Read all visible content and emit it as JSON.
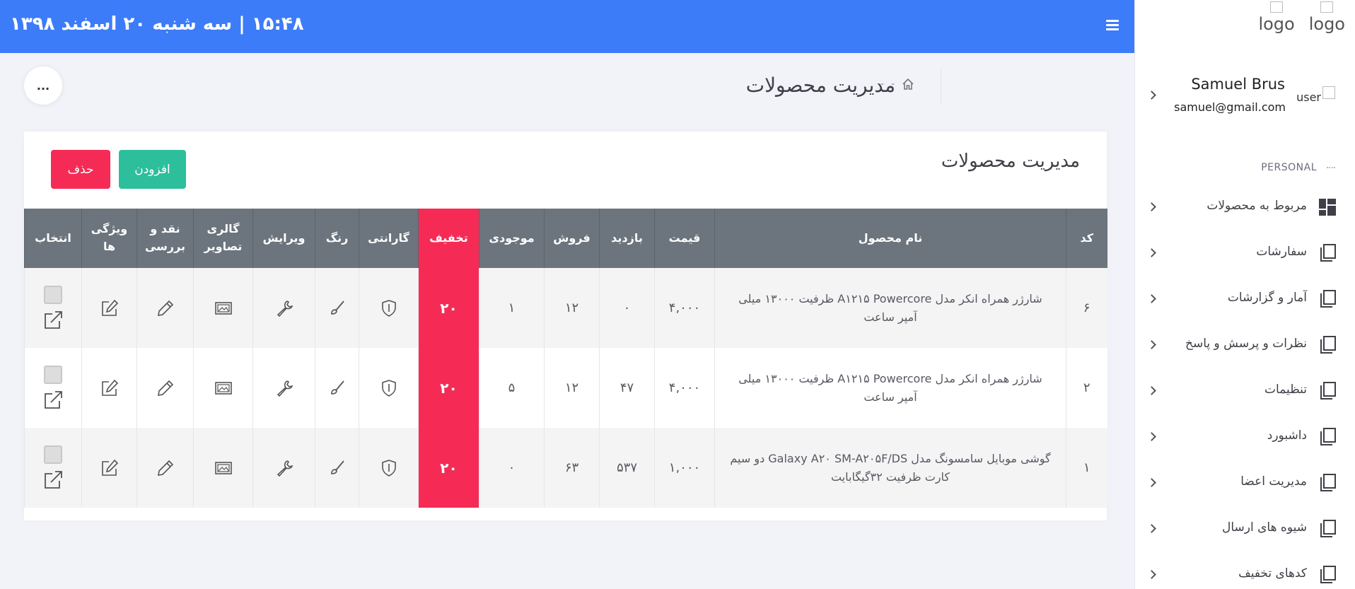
{
  "header": {
    "datetime": "۱۵:۴۸ | سه شنبه ۲۰ اسفند ۱۳۹۸"
  },
  "sidebar": {
    "logos": [
      "logo",
      "logo"
    ],
    "user": {
      "icon_label": "user",
      "name": "Samuel Brus",
      "email": "samuel@gmail.com"
    },
    "section_title": "PERSONAL",
    "items": [
      {
        "label": "مربوط به محصولات",
        "icon": "dashboard-grid-icon"
      },
      {
        "label": "سفارشات",
        "icon": "copy-icon"
      },
      {
        "label": "آمار و گزارشات",
        "icon": "copy-icon"
      },
      {
        "label": "نظرات و پرسش و پاسخ",
        "icon": "copy-icon"
      },
      {
        "label": "تنظیمات",
        "icon": "copy-icon"
      },
      {
        "label": "داشبورد",
        "icon": "copy-icon"
      },
      {
        "label": "مدیریت اعضا",
        "icon": "copy-icon"
      },
      {
        "label": "شیوه های ارسال",
        "icon": "copy-icon"
      },
      {
        "label": "کدهای تخفیف",
        "icon": "copy-icon"
      }
    ]
  },
  "subheader": {
    "title": "مدیریت محصولات",
    "crumb_sep1": "-",
    "crumb_sep2": "-",
    "more_label": "..."
  },
  "card": {
    "title": "مدیریت محصولات",
    "add_label": "افزودن",
    "delete_label": "حذف"
  },
  "table": {
    "columns": [
      "کد",
      "نام محصول",
      "قیمت",
      "بازدید",
      "فروش",
      "موجودی",
      "تخفیف",
      "گارانتی",
      "رنگ",
      "ویرایش",
      "گالری تصاویر",
      "نقد و بررسی",
      "ویژگی ها",
      "انتخاب"
    ],
    "rows": [
      {
        "code": "۶",
        "name": "شارژر همراه انکر مدل A۱۲۱۵ Powercore ظرفیت ۱۳۰۰۰ میلی آمپر ساعت",
        "price": "۴,۰۰۰",
        "views": "۰",
        "sales": "۱۲",
        "stock": "۱",
        "discount": "۲۰"
      },
      {
        "code": "۲",
        "name": "شارژر همراه انکر مدل A۱۲۱۵ Powercore ظرفیت ۱۳۰۰۰ میلی آمپر ساعت",
        "price": "۴,۰۰۰",
        "views": "۴۷",
        "sales": "۱۲",
        "stock": "۵",
        "discount": "۲۰"
      },
      {
        "code": "۱",
        "name": "گوشی موبایل سامسونگ مدل Galaxy A۲۰ SM-A۲۰۵F/DS دو سیم کارت ظرفیت ۳۲گیگابایت",
        "price": "۱,۰۰۰",
        "views": "۵۳۷",
        "sales": "۶۳",
        "stock": "۰",
        "discount": "۲۰"
      }
    ]
  },
  "colors": {
    "primary": "#3d7cf8",
    "accent_red": "#f52b56",
    "success": "#2dbf9c",
    "table_header": "#6c757d"
  }
}
